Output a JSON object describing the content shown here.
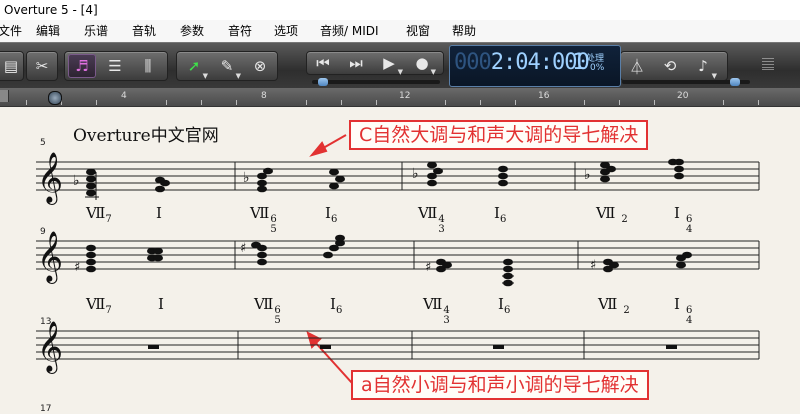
{
  "window": {
    "title": "Overture 5 - [4]"
  },
  "menu": [
    "文件",
    "编辑",
    "乐谱",
    "音轨",
    "参数",
    "音符",
    "选项",
    "音频/ MIDI",
    "视窗",
    "帮助"
  ],
  "counter": {
    "time_dim": "000",
    "time": "2:04:000",
    "beat": "1",
    "label": "处理",
    "percent": "0%"
  },
  "ruler": {
    "marks": [
      "4",
      "8",
      "12",
      "16",
      "20"
    ]
  },
  "score": {
    "heading": "Overture中文官网",
    "callout_top": "C自然大调与和声大调的导七解决",
    "callout_bottom": "a自然小调与和声小调的导七解决",
    "measure_numbers": [
      "5",
      "9",
      "13",
      "17"
    ],
    "row1_labels": [
      {
        "main": "Ⅶ",
        "sub": "7",
        "sup": ""
      },
      {
        "main": "Ⅰ",
        "sub": "",
        "sup": ""
      },
      {
        "main": "Ⅶ",
        "sub": "5",
        "sup": "6"
      },
      {
        "main": "Ⅰ",
        "sub": "6",
        "sup": ""
      },
      {
        "main": "Ⅶ",
        "sub": "3",
        "sup": "4"
      },
      {
        "main": "Ⅰ",
        "sub": "6",
        "sup": ""
      },
      {
        "main": "Ⅶ",
        "sub": "2",
        "sup": ""
      },
      {
        "main": "Ⅰ",
        "sub": "4",
        "sup": "6"
      }
    ],
    "row2_labels": [
      {
        "main": "Ⅶ",
        "sub": "7",
        "sup": ""
      },
      {
        "main": "Ⅰ",
        "sub": "",
        "sup": ""
      },
      {
        "main": "Ⅶ",
        "sub": "5",
        "sup": "6"
      },
      {
        "main": "Ⅰ",
        "sub": "6",
        "sup": ""
      },
      {
        "main": "Ⅶ",
        "sub": "3",
        "sup": "4"
      },
      {
        "main": "Ⅰ",
        "sub": "6",
        "sup": ""
      },
      {
        "main": "Ⅶ",
        "sub": "2",
        "sup": ""
      },
      {
        "main": "Ⅰ",
        "sub": "4",
        "sup": "6"
      }
    ]
  },
  "colors": {
    "callout": "#e23232",
    "counter_text": "#9fd1ff",
    "paper": "#f4f1ea"
  }
}
